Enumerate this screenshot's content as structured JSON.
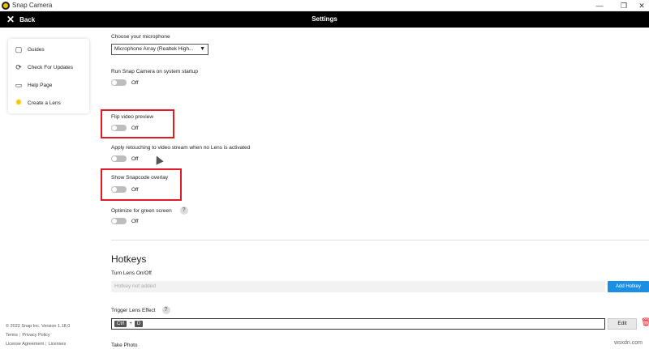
{
  "window": {
    "app_title": "Snap Camera",
    "controls": {
      "minimize": "—",
      "maximize": "❐",
      "close": "✕"
    }
  },
  "header": {
    "back_label": "Back",
    "title": "Settings"
  },
  "sidebar": {
    "items": [
      {
        "label": "Guides",
        "icon": "guides-icon"
      },
      {
        "label": "Check For Updates",
        "icon": "refresh-icon"
      },
      {
        "label": "Help Page",
        "icon": "help-icon"
      },
      {
        "label": "Create a Lens",
        "icon": "lens-icon"
      }
    ]
  },
  "footer": {
    "copyright": "© 2022 Snap Inc. Version 1.18.0",
    "links": [
      "Terms",
      "Privacy Policy",
      "License Agreement",
      "Licenses"
    ]
  },
  "settings": {
    "microphone": {
      "label": "Choose your microphone",
      "value": "Microphone Array (Realtek High..."
    },
    "run_on_startup": {
      "label": "Run Snap Camera on system startup",
      "state": "Off"
    },
    "flip_video": {
      "label": "Flip video preview",
      "state": "Off"
    },
    "retouching": {
      "label": "Apply retouching to video stream when no Lens is activated",
      "state": "Off"
    },
    "snapcode_overlay": {
      "label": "Show Snapcode overlay",
      "state": "Off"
    },
    "green_screen": {
      "label": "Optimize for green screen",
      "state": "Off"
    }
  },
  "hotkeys": {
    "title": "Hotkeys",
    "turn_lens": {
      "label": "Turn Lens On/Off",
      "placeholder": "Hotkey not added",
      "button": "Add Hotkey"
    },
    "trigger_effect": {
      "label": "Trigger Lens Effect",
      "keys": [
        "Ctrl",
        "+",
        "D"
      ],
      "button": "Edit"
    },
    "take_photo": {
      "label": "Take Photo"
    }
  },
  "watermark": "wsxdn.com",
  "colors": {
    "header_bg": "#000000",
    "highlight_box": "#e01b24",
    "primary_button": "#1a8fe3",
    "toggle_off": "#bdbdbd"
  }
}
